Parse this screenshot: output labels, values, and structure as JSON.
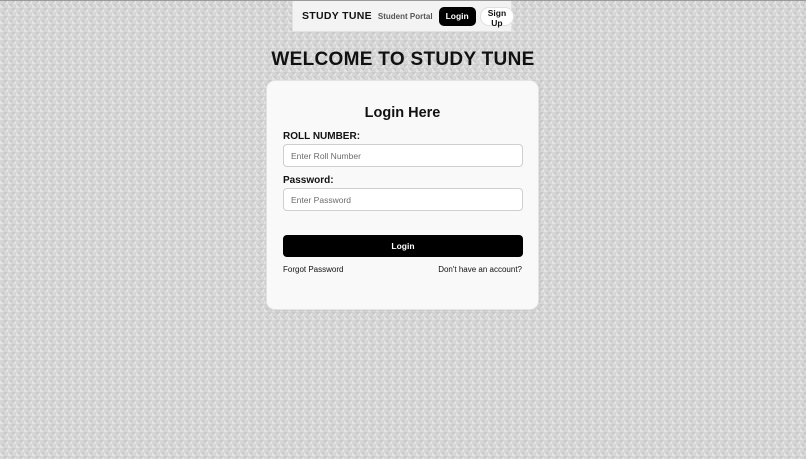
{
  "navbar": {
    "brand": "STUDY TUNE",
    "portal": "Student Portal",
    "login_label": "Login",
    "signup_label": "Sign Up"
  },
  "page": {
    "welcome": "WELCOME TO STUDY TUNE"
  },
  "login_card": {
    "title": "Login Here",
    "roll_label": "ROLL NUMBER:",
    "roll_placeholder": "Enter Roll Number",
    "roll_value": "",
    "password_label": "Password:",
    "password_placeholder": "Enter Password",
    "password_value": "",
    "submit_label": "Login",
    "forgot_link": "Forgot Password",
    "signup_link": "Don't have an account?"
  },
  "colors": {
    "accent": "#000000",
    "background": "#d6d6d6",
    "card": "#f9f9f9"
  }
}
